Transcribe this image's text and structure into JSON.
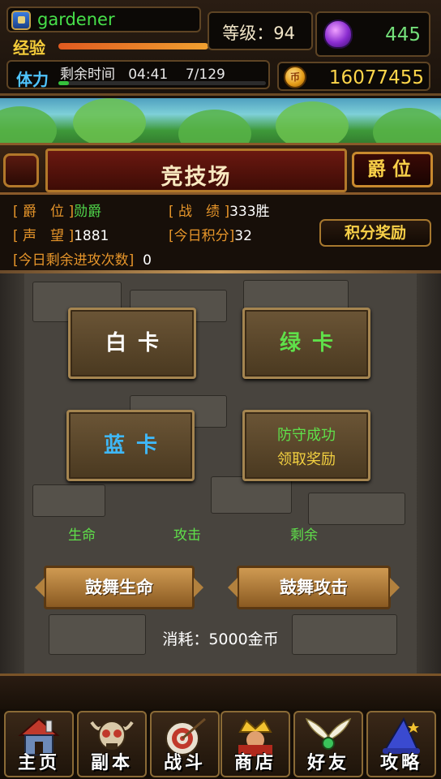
{
  "player": {
    "name": "gardener"
  },
  "level": {
    "text": "等级：94"
  },
  "exp": {
    "label": "经验",
    "progress": 0.6
  },
  "stamina": {
    "label": "体力",
    "remaining_label": "剩余时间",
    "timer": "04:41",
    "count": "7/129",
    "progress": 0.05
  },
  "currency": {
    "gems": "445",
    "coins": "16077455",
    "coin_glyph": "币"
  },
  "arena": {
    "title": "竞技场",
    "rank_button": "爵位"
  },
  "info": {
    "rank_label": "[ 爵　位 ]",
    "rank_value": "勋爵",
    "record_label": "[ 战　绩 ]",
    "record_value": "333胜",
    "prestige_label": "[ 声　望 ]",
    "prestige_value": "1881",
    "today_points_label": "[今日积分]",
    "today_points_value": "32",
    "attacks_label": "[今日剩余进攻次数]",
    "attacks_value": "0",
    "reward_button": "积分奖励"
  },
  "cards": {
    "white": "白卡",
    "green": "绿卡",
    "blue": "蓝卡",
    "defend_line1": "防守成功",
    "defend_line2": "领取奖励"
  },
  "stats": {
    "life": "生命",
    "attack": "攻击",
    "remaining": "剩余"
  },
  "inspire": {
    "life_button": "鼓舞生命",
    "attack_button": "鼓舞攻击",
    "cost": "消耗：5000金币"
  },
  "nav": [
    {
      "label": "主页",
      "icon": "house-icon"
    },
    {
      "label": "副本",
      "icon": "skull-icon"
    },
    {
      "label": "战斗",
      "icon": "target-icon"
    },
    {
      "label": "商店",
      "icon": "crown-icon"
    },
    {
      "label": "好友",
      "icon": "wings-icon"
    },
    {
      "label": "攻略",
      "icon": "wizard-hat-icon"
    }
  ],
  "colors": {
    "gold": "#f8d048",
    "green": "#5fe04a",
    "blue": "#3fb8f8",
    "orange_label": "#e6952a"
  }
}
